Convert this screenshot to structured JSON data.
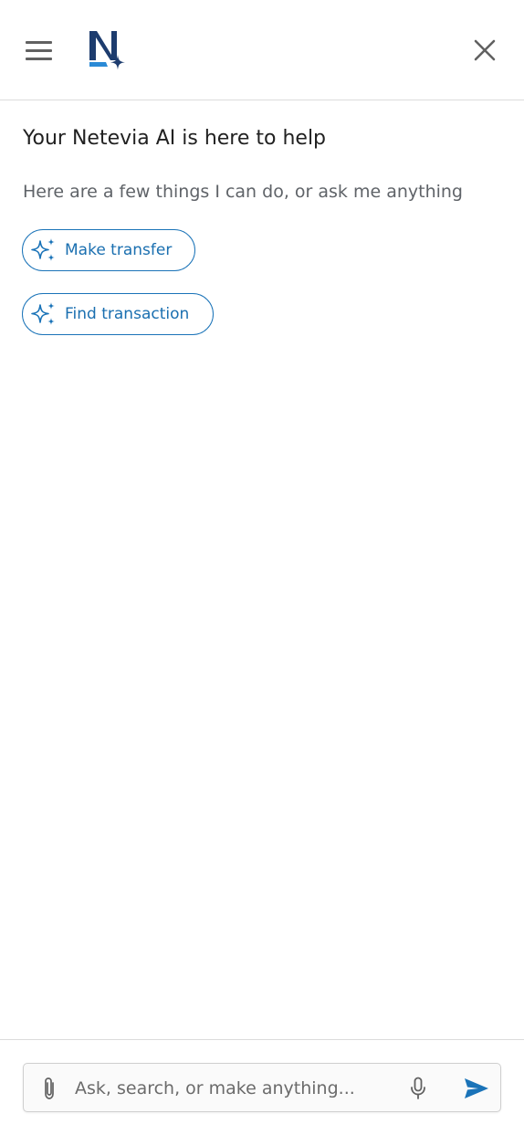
{
  "colors": {
    "accent": "#1a73b8",
    "logo_dark": "#1d3c6e",
    "logo_light": "#2a8ad6",
    "text_primary": "#212121",
    "text_secondary": "#5f6368"
  },
  "header": {
    "menu_icon": "hamburger-menu-icon",
    "logo_icon": "netevia-logo",
    "close_icon": "close-icon"
  },
  "main": {
    "heading": "Your Netevia AI is here to help",
    "subheading": "Here are a few things I can do, or ask me anything",
    "suggestions": [
      {
        "label": "Make transfer",
        "icon": "sparkle-icon"
      },
      {
        "label": "Find transaction",
        "icon": "sparkle-icon"
      }
    ]
  },
  "composer": {
    "placeholder": "Ask, search, or make anything...",
    "value": "",
    "attach_icon": "paperclip-icon",
    "mic_icon": "microphone-icon",
    "send_icon": "send-icon"
  }
}
